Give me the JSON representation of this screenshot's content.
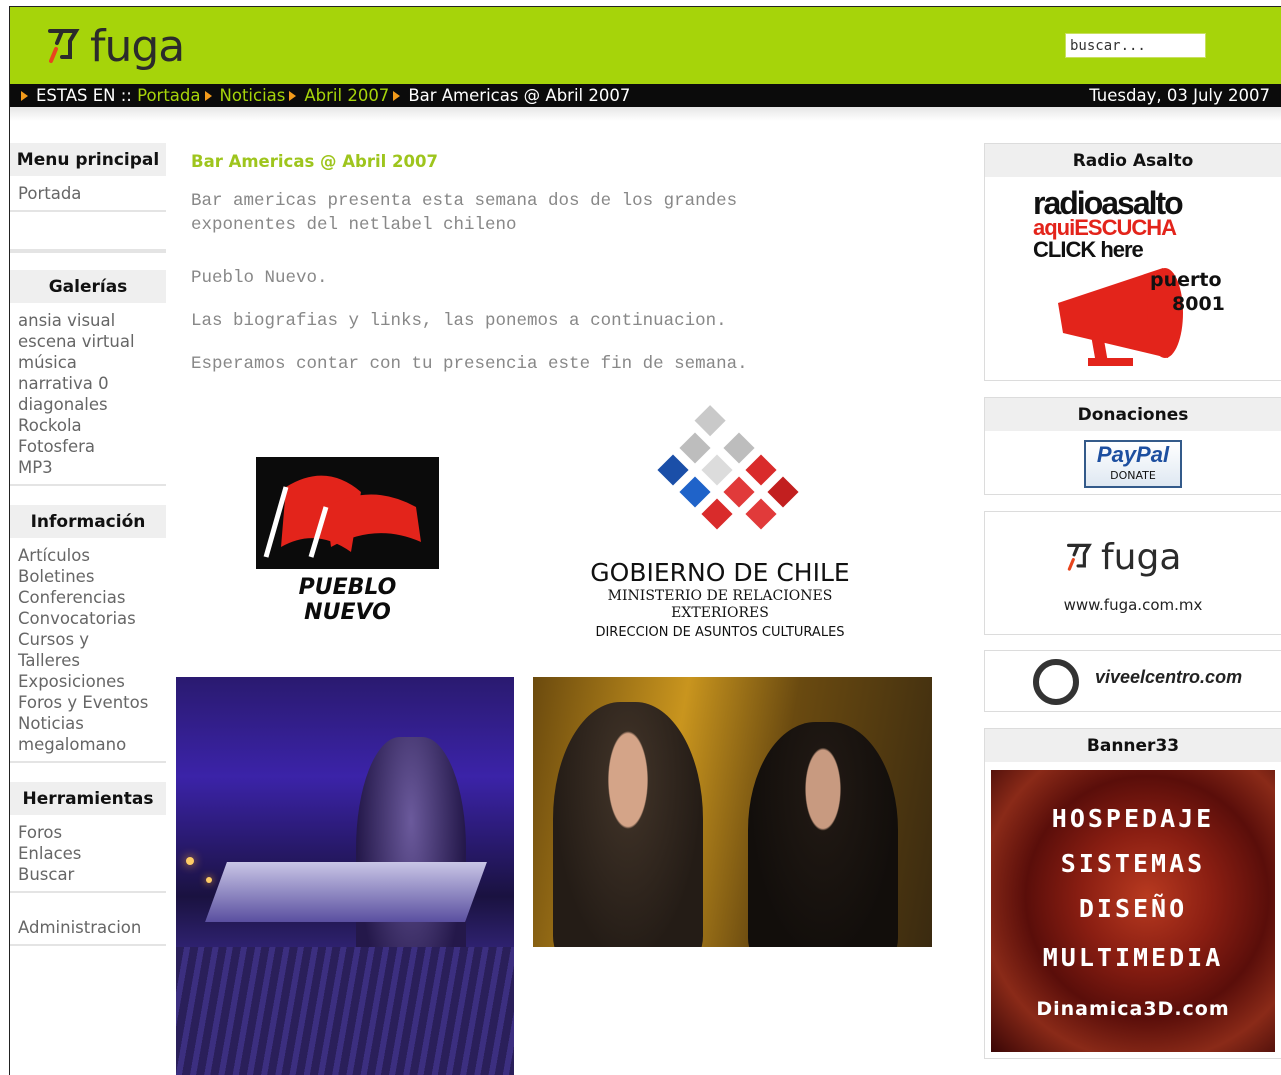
{
  "header": {
    "logo_text": "fuga",
    "search_placeholder": "buscar..."
  },
  "breadcrumb": {
    "prefix": "ESTAS EN ::",
    "items": [
      "Portada",
      "Noticias",
      "Abril 2007"
    ],
    "current": "Bar Americas @ Abril 2007",
    "date": "Tuesday, 03 July 2007"
  },
  "sidebar": {
    "menu": {
      "title": "Menu principal",
      "items": [
        "Portada"
      ]
    },
    "galerias": {
      "title": "Galerías",
      "items": [
        "ansia visual",
        "escena virtual",
        "música",
        "narrativa 0",
        "diagonales",
        "Rockola",
        "Fotosfera",
        "MP3"
      ]
    },
    "informacion": {
      "title": "Información",
      "items": [
        "Artículos",
        "Boletines",
        "Conferencias",
        "Convocatorias",
        "Cursos y",
        "Talleres",
        "Exposiciones",
        "Foros y Eventos",
        "Noticias",
        "megalomano"
      ]
    },
    "herramientas": {
      "title": "Herramientas",
      "items": [
        "Foros",
        "Enlaces",
        "Buscar"
      ]
    },
    "admin": {
      "items": [
        "Administracion"
      ]
    }
  },
  "article": {
    "title": "Bar Americas @ Abril 2007",
    "paragraphs": [
      "Bar americas presenta esta semana dos de los grandes",
      "exponentes del netlabel chileno",
      "Pueblo Nuevo.",
      "Las biografias y links, las ponemos a continuacion.",
      "Esperamos contar con tu presencia este fin de semana."
    ],
    "pueblo_logo_text": "PUEBLO NUEVO",
    "gobierno": {
      "line1": "GOBIERNO DE CHILE",
      "line2": "MINISTERIO DE RELACIONES",
      "line3": "EXTERIORES",
      "line4": "DIRECCION DE ASUNTOS CULTURALES"
    }
  },
  "right": {
    "radio": {
      "title": "Radio Asalto",
      "logo": "radioasalto",
      "tag1": "aquiESCUCHA",
      "tag2": "CLICK here",
      "puerto1": "puerto",
      "puerto2": "8001"
    },
    "donaciones": {
      "title": "Donaciones",
      "paypal": "PayPal",
      "donate": "DONATE"
    },
    "fuga_banner": {
      "logo": "fuga",
      "url": "www.fuga.com.mx"
    },
    "vive": {
      "text": "viveelcentro.com"
    },
    "banner33": {
      "title": "Banner33",
      "lines": [
        "HOSPEDAJE",
        "SISTEMAS",
        "DISEÑO",
        "MULTIMEDIA"
      ],
      "site": "Dinamica3D.com"
    }
  },
  "colors": {
    "accent": "#a6d40a",
    "bar": "#0b0b0b",
    "arrow": "#f39b1b",
    "title": "#9ec51d"
  }
}
